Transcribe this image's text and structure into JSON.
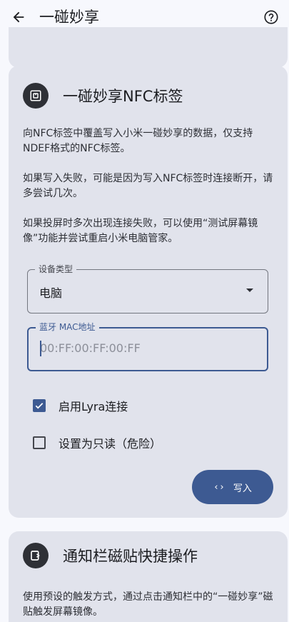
{
  "appbar": {
    "title": "一碰妙享",
    "back_icon": "arrow-back-icon",
    "help_icon": "help-circle-icon"
  },
  "nfc_card": {
    "title": "一碰妙享NFC标签",
    "icon": "nfc-icon",
    "paragraphs": [
      "向NFC标签中覆盖写入小米一碰妙享的数据，仅支持NDEF格式的NFC标签。",
      "如果写入失败，可能是因为写入NFC标签时连接断开，请多尝试几次。",
      "如果投屏时多次出现连接失败，可以使用“测试屏幕镜像”功能并尝试重启小米电脑管家。"
    ],
    "device_type": {
      "label": "设备类型",
      "value": "电脑"
    },
    "mac_field": {
      "label": "蓝牙 MAC地址",
      "placeholder": "00:FF:00:FF:00:FF"
    },
    "checkboxes": [
      {
        "label": "启用Lyra连接",
        "checked": true
      },
      {
        "label": "设置为只读（危险）",
        "checked": false
      }
    ],
    "write_button": {
      "icon_glyph": "‹›",
      "label": "写入"
    }
  },
  "tile_card": {
    "title": "通知栏磁贴快捷操作",
    "icon": "tile-icon",
    "paragraph": "使用预设的触发方式，通过点击通知栏中的“一碰妙享”磁贴触发屏幕镜像。"
  },
  "colors": {
    "background": "#f7f8fd",
    "card": "#e1e3ec",
    "accent": "#3d5a92",
    "icon_circle": "#2e3036"
  }
}
